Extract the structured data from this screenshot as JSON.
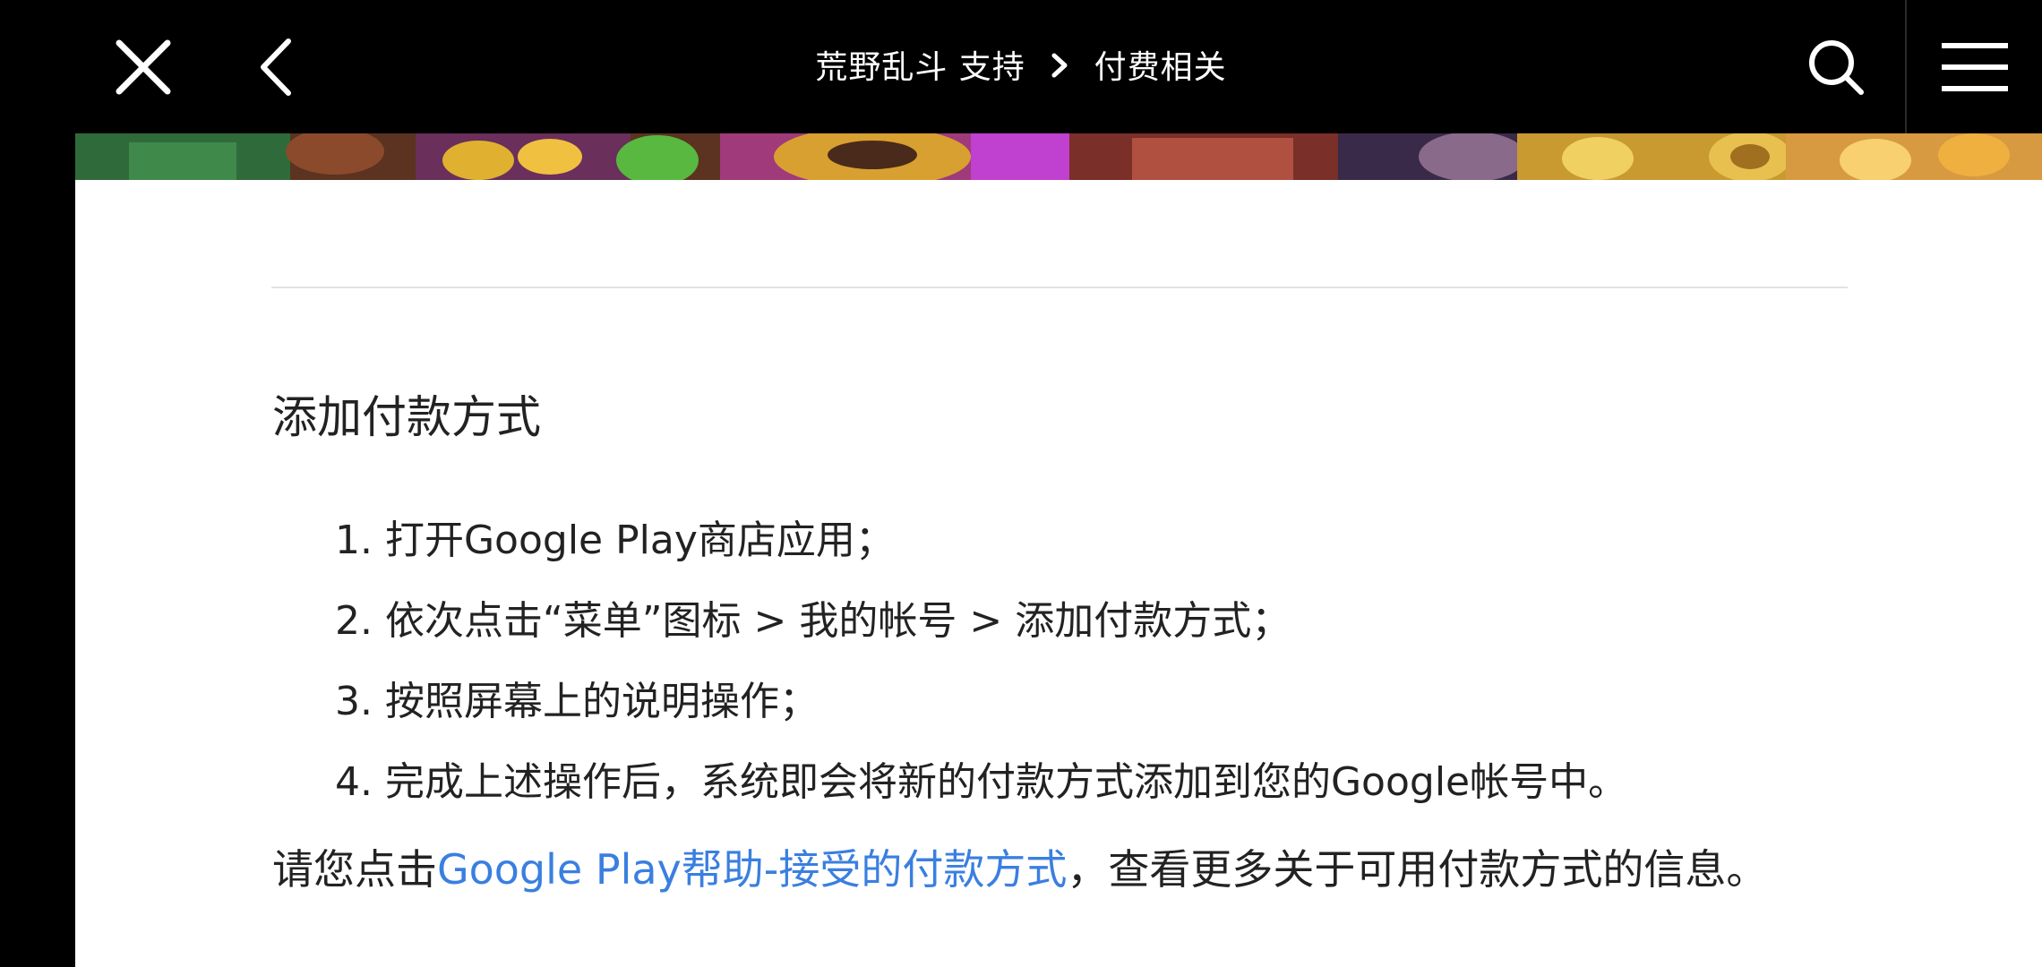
{
  "header": {
    "breadcrumb": [
      "荒野乱斗 支持",
      "付费相关"
    ],
    "icons": {
      "close": "close-icon",
      "back": "chevron-left-icon",
      "search": "search-icon",
      "menu": "hamburger-menu-icon"
    }
  },
  "main": {
    "section_title": "添加付款方式",
    "steps": [
      "1. 打开Google Play商店应用；",
      "2. 依次点击“菜单”图标 > 我的帐号 > 添加付款方式；",
      "3. 按照屏幕上的说明操作；",
      "4. 完成上述操作后，系统即会将新的付款方式添加到您的Google帐号中。"
    ],
    "footer": {
      "prefix": "请您点击",
      "link_text": "Google Play帮助-接受的付款方式",
      "suffix": "，查看更多关于可用付款方式的信息。"
    }
  },
  "colors": {
    "link": "#3a7fe0",
    "background": "#000000",
    "content_bg": "#ffffff"
  }
}
